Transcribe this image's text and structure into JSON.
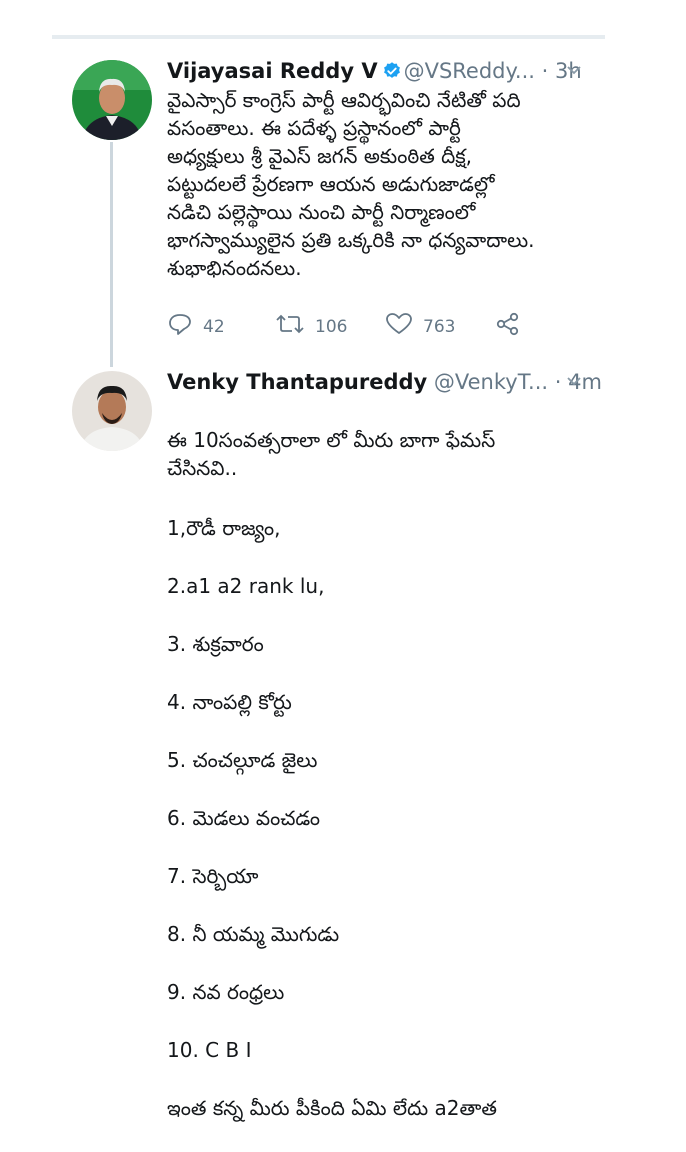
{
  "tweet1": {
    "name": "Vijayasai Reddy V",
    "handle": "@VSReddy...",
    "separator": "·",
    "time": "3h",
    "body": "వైఎస్సార్ కాంగ్రెస్ పార్టీ ఆవిర్భవించి నేటితో పది\nవసంతాలు. ఈ పదేళ్ళ ప్రస్థానంలో పార్టీ\nఅధ్యక్షులు శ్రీ వైఎస్ జగన్ అకుంఠిత దీక్ష,\nపట్టుదలలే ప్రేరణగా ఆయన అడుగుజాడల్లో\nనడిచి పల్లెస్థాయి నుంచి పార్టీ నిర్మాణంలో\nభాగస్వామ్యులైన ప్రతి ఒక్కరికి నా ధన్యవాదాలు.\nశుభాభినందనలు.",
    "replies": "42",
    "retweets": "106",
    "likes": "763",
    "colors": {
      "verified": "#1da1f2",
      "muted": "#657786"
    }
  },
  "tweet2": {
    "name": "Venky Thantapureddy",
    "handle": "@VenkyT...",
    "separator": "·",
    "time": "4m",
    "intro": "ఈ 10సంవత్సరాలా లో మీరు బాగా ఫేమస్\nచేసినవి..",
    "items": [
      "1,రౌడీ రాజ్యం,",
      "2.a1 a2 rank lu,",
      "3. శుక్రవారం",
      "4. నాంపల్లి కోర్టు",
      "5. చంచల్గూడ జైలు",
      "6. మెడలు వంచడం",
      "7. సెర్బియా",
      "8. నీ యమ్మ మొగుడు",
      "9. నవ రంధ్రలు",
      "10. C B I"
    ],
    "closing": "ఇంత కన్న మీరు పీకింది ఏమి లేదు a2తాత"
  },
  "icons": {
    "verified": "verified-badge-icon",
    "chevron": "chevron-down-icon",
    "reply": "reply-icon",
    "retweet": "retweet-icon",
    "like": "heart-icon",
    "share": "share-icon"
  }
}
